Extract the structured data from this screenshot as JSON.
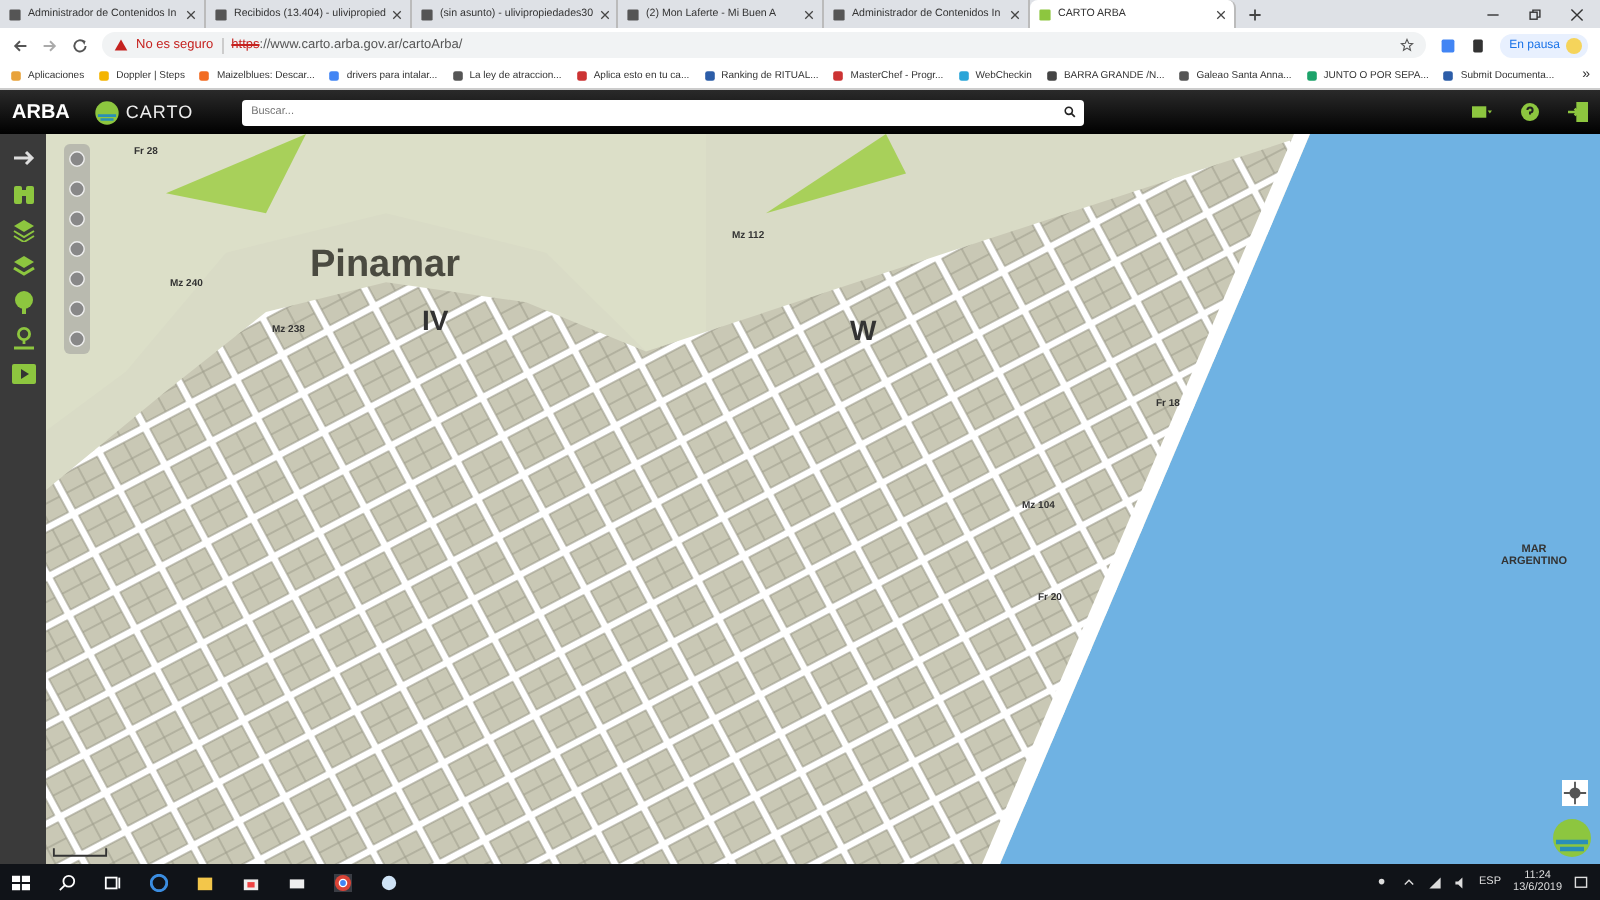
{
  "browser": {
    "tabs": [
      {
        "title": "Administrador de Contenidos In",
        "selected": false
      },
      {
        "title": "Recibidos (13.404) - ulivipropied",
        "selected": false
      },
      {
        "title": "(sin asunto) - ulivipropiedades30",
        "selected": false
      },
      {
        "title": "(2) Mon Laferte - Mi Buen A",
        "selected": false
      },
      {
        "title": "Administrador de Contenidos In",
        "selected": false
      },
      {
        "title": "CARTO ARBA",
        "selected": true
      }
    ],
    "address_bar": {
      "security_label": "No es seguro",
      "url_scheme": "https",
      "url_rest": "://www.carto.arba.gov.ar/cartoArba/"
    },
    "profile": {
      "label": "En pausa"
    },
    "bookmarks": [
      "Aplicaciones",
      "Doppler | Steps",
      "Maizelblues: Descar...",
      "drivers para intalar...",
      "La ley de atraccion...",
      "Aplica esto en tu ca...",
      "Ranking de RITUAL...",
      "MasterChef - Progr...",
      "WebCheckin",
      "BARRA GRANDE /N...",
      "Galeao Santa Anna...",
      "JUNTO O POR SEPA...",
      "Submit Documenta..."
    ],
    "bookmarks_overflow": "»"
  },
  "app": {
    "brand": "ARBA",
    "product": "CARTO",
    "search": {
      "placeholder": "Buscar..."
    }
  },
  "map": {
    "labels": [
      {
        "text": "Pinamar",
        "kind": "city"
      },
      {
        "text": "IV",
        "kind": "zone"
      },
      {
        "text": "W",
        "kind": "zone"
      },
      {
        "text": "MAR ARGENTINO",
        "kind": "sea"
      },
      {
        "text": "Fr 28",
        "kind": "block"
      },
      {
        "text": "Mz 240",
        "kind": "block"
      },
      {
        "text": "Mz 238",
        "kind": "block"
      },
      {
        "text": "Mz 112",
        "kind": "block"
      },
      {
        "text": "Mz 104",
        "kind": "block"
      },
      {
        "text": "Fr 18",
        "kind": "block"
      },
      {
        "text": "Fr 20",
        "kind": "block"
      }
    ]
  },
  "taskbar": {
    "language": "ESP",
    "time": "11:24",
    "date": "13/6/2019"
  }
}
